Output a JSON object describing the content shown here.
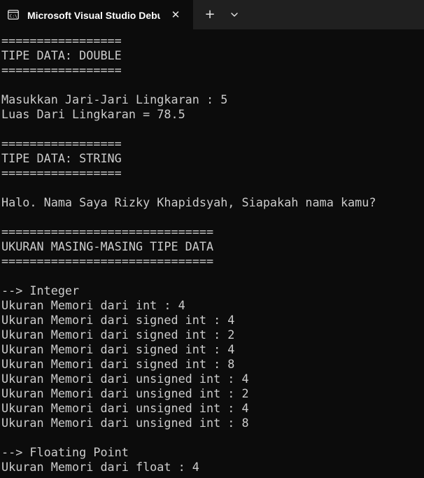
{
  "titlebar": {
    "tab_icon": "terminal-icon",
    "tab_title": "Microsoft Visual Studio Debug Console",
    "close_glyph": "✕",
    "new_tab_glyph": "+",
    "dropdown_icon": "chevron-down-icon"
  },
  "colors": {
    "background": "#0c0c0c",
    "titlebar": "#202020",
    "text": "#cccccc"
  },
  "console": {
    "lines": [
      "=================",
      "TIPE DATA: DOUBLE",
      "=================",
      "",
      "Masukkan Jari-Jari Lingkaran : 5",
      "Luas Dari Lingkaran = 78.5",
      "",
      "=================",
      "TIPE DATA: STRING",
      "=================",
      "",
      "Halo. Nama Saya Rizky Khapidsyah, Siapakah nama kamu?",
      "",
      "==============================",
      "UKURAN MASING-MASING TIPE DATA",
      "==============================",
      "",
      "--> Integer",
      "Ukuran Memori dari int : 4",
      "Ukuran Memori dari signed int : 4",
      "Ukuran Memori dari signed int : 2",
      "Ukuran Memori dari signed int : 4",
      "Ukuran Memori dari signed int : 8",
      "Ukuran Memori dari unsigned int : 4",
      "Ukuran Memori dari unsigned int : 2",
      "Ukuran Memori dari unsigned int : 4",
      "Ukuran Memori dari unsigned int : 8",
      "",
      "--> Floating Point",
      "Ukuran Memori dari float : 4"
    ]
  }
}
